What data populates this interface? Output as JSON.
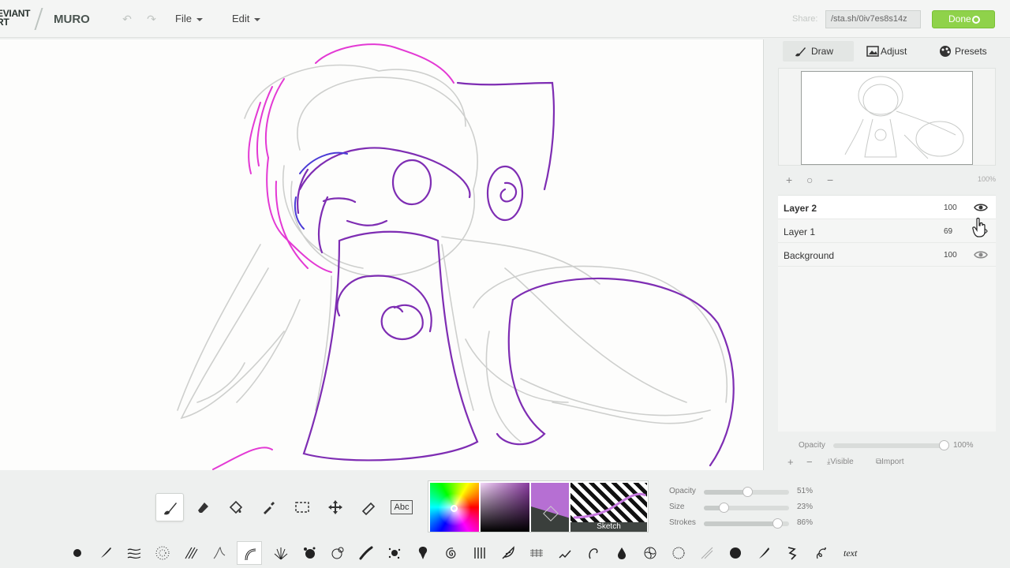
{
  "app": {
    "logo_line1": "EVIANT",
    "logo_line2": "RT",
    "name": "MURO"
  },
  "header": {
    "undo_icon": "undo-icon",
    "redo_icon": "redo-icon",
    "file_menu": "File",
    "edit_menu": "Edit",
    "share_label": "Share:",
    "share_url": "/sta.sh/0iv7es8s14z",
    "done_label": "Done"
  },
  "panel": {
    "tabs": [
      {
        "label": "Draw",
        "icon": "brush-icon"
      },
      {
        "label": "Adjust",
        "icon": "image-icon"
      },
      {
        "label": "Presets",
        "icon": "palette-icon"
      }
    ],
    "zoom": "100%",
    "layers": [
      {
        "name": "Layer 2",
        "opacity": "100",
        "visible": true,
        "active": true
      },
      {
        "name": "Layer 1",
        "opacity": "69",
        "visible": true,
        "active": false
      },
      {
        "name": "Background",
        "opacity": "100",
        "visible": true,
        "active": false
      }
    ],
    "opacity_label": "Opacity",
    "opacity_value": "100%",
    "opacity_fraction": 1.0,
    "actions": {
      "visible": "Visible",
      "import": "Import"
    }
  },
  "tools": [
    "brush-tool-icon",
    "eraser-icon",
    "bucket-icon",
    "eyedropper-icon",
    "selection-icon",
    "move-icon",
    "smudge-icon",
    "text-tool-icon"
  ],
  "text_tool_label": "Abc",
  "color": {
    "current": "#b66fd3",
    "brush_name": "Sketch"
  },
  "brush_settings": [
    {
      "label": "Opacity",
      "value": "51%",
      "fraction": 0.51
    },
    {
      "label": "Size",
      "value": "23%",
      "fraction": 0.23
    },
    {
      "label": "Strokes",
      "value": "86%",
      "fraction": 0.86
    }
  ],
  "brushes_text_label": "text"
}
